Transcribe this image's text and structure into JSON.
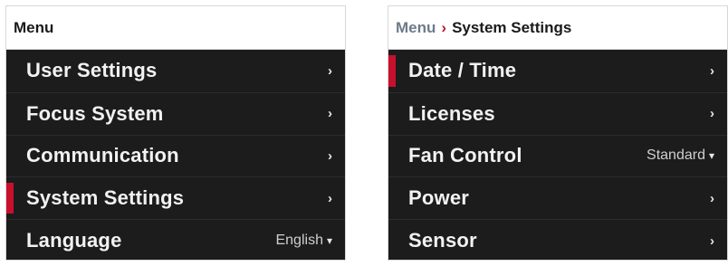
{
  "accent_color": "#c8102e",
  "left_menu": {
    "header": "Menu",
    "items": [
      {
        "label": "User Settings",
        "arrow": "›"
      },
      {
        "label": "Focus System",
        "arrow": "›"
      },
      {
        "label": "Communication",
        "arrow": "›"
      },
      {
        "label": "System Settings",
        "arrow": "›",
        "selected": true
      },
      {
        "label": "Language",
        "value": "English",
        "caret": "▾"
      }
    ]
  },
  "right_menu": {
    "header_parent": "Menu",
    "header_separator": "›",
    "header_current": "System Settings",
    "items": [
      {
        "label": "Date / Time",
        "arrow": "›",
        "selected": true
      },
      {
        "label": "Licenses",
        "arrow": "›"
      },
      {
        "label": "Fan Control",
        "value": "Standard",
        "caret": "▾"
      },
      {
        "label": "Power",
        "arrow": "›"
      },
      {
        "label": "Sensor",
        "arrow": "›"
      }
    ]
  }
}
